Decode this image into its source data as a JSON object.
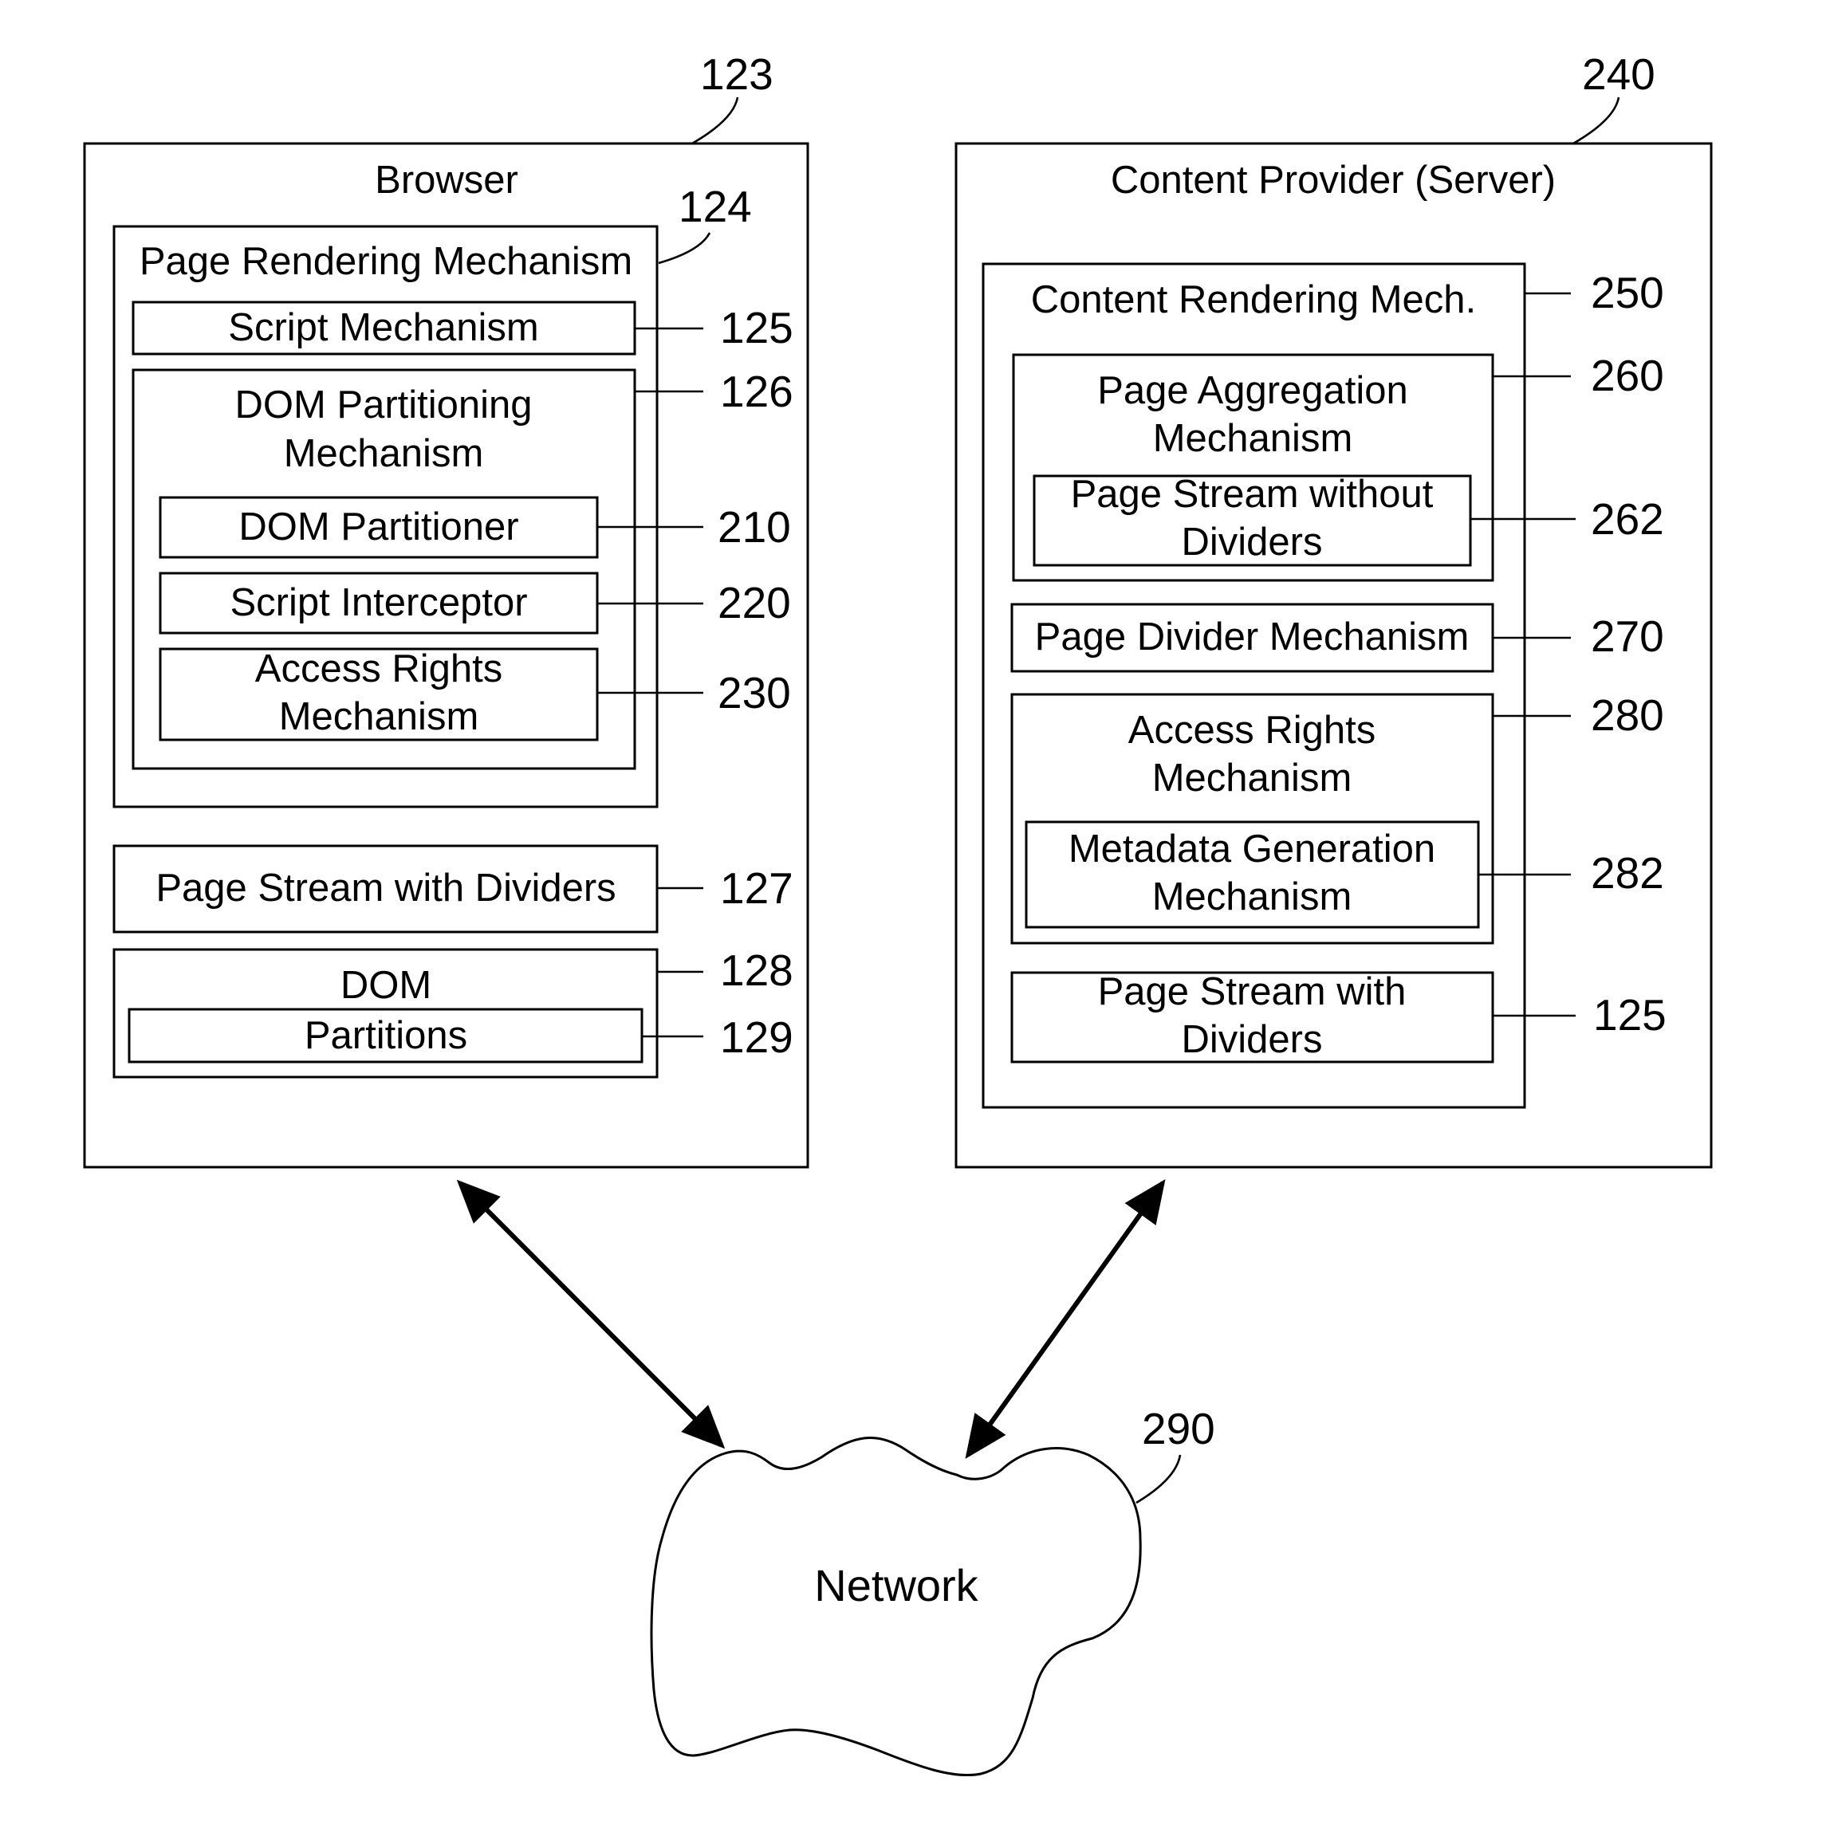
{
  "figure": {
    "browser": {
      "ref": "123",
      "title": "Browser",
      "page_rendering": {
        "ref": "124",
        "title": "Page Rendering Mechanism",
        "script_mechanism": {
          "ref": "125",
          "label": "Script Mechanism"
        },
        "dom_partitioning": {
          "ref": "126",
          "title_line1": "DOM Partitioning",
          "title_line2": "Mechanism",
          "dom_partitioner": {
            "ref": "210",
            "label": "DOM Partitioner"
          },
          "script_interceptor": {
            "ref": "220",
            "label": "Script Interceptor"
          },
          "access_rights": {
            "ref": "230",
            "line1": "Access Rights",
            "line2": "Mechanism"
          }
        }
      },
      "page_stream": {
        "ref": "127",
        "label": "Page Stream with Dividers"
      },
      "dom": {
        "ref": "128",
        "label": "DOM",
        "partitions": {
          "ref": "129",
          "label": "Partitions"
        }
      }
    },
    "server": {
      "ref": "240",
      "title": "Content Provider (Server)",
      "content_rendering": {
        "ref": "250",
        "title": "Content Rendering Mech.",
        "page_aggregation": {
          "ref": "260",
          "line1": "Page Aggregation",
          "line2": "Mechanism",
          "page_stream_without": {
            "ref": "262",
            "line1": "Page Stream without",
            "line2": "Dividers"
          }
        },
        "page_divider": {
          "ref": "270",
          "label": "Page Divider Mechanism"
        },
        "access_rights": {
          "ref": "280",
          "line1": "Access Rights",
          "line2": "Mechanism",
          "metadata_generation": {
            "ref": "282",
            "line1": "Metadata Generation",
            "line2": "Mechanism"
          }
        },
        "page_stream_with": {
          "ref": "125",
          "line1": "Page Stream with",
          "line2": "Dividers"
        }
      }
    },
    "network": {
      "ref": "290",
      "label": "Network"
    }
  }
}
